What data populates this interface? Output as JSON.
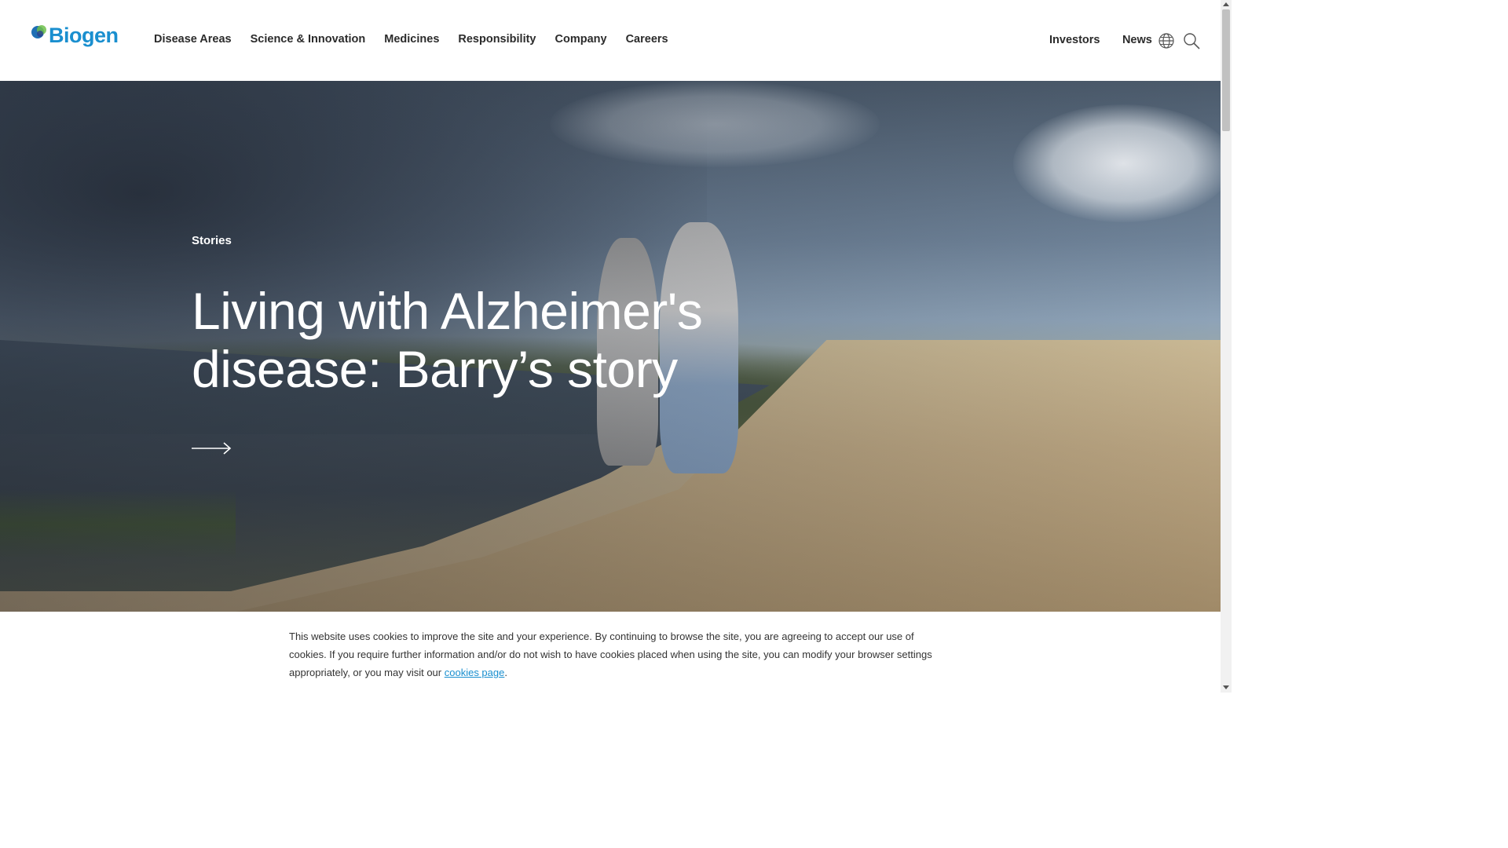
{
  "brand": {
    "name": "Biogen",
    "logo_icon": "biogen-logo-icon",
    "accent": "#1a8fcf"
  },
  "nav": {
    "items": [
      {
        "label": "Disease Areas"
      },
      {
        "label": "Science & Innovation"
      },
      {
        "label": "Medicines"
      },
      {
        "label": "Responsibility"
      },
      {
        "label": "Company"
      },
      {
        "label": "Careers"
      }
    ],
    "right": [
      {
        "label": "Investors"
      },
      {
        "label": "News"
      }
    ],
    "icons": [
      "globe-icon",
      "search-icon"
    ]
  },
  "hero": {
    "eyebrow": "Stories",
    "headline": "Living with Alzheimer's disease: Barry’s story",
    "cta_icon": "arrow-right-icon"
  },
  "cookie": {
    "text": "This website uses cookies to improve the site and your experience. By continuing to browse the site, you are agreeing to accept our use of cookies. If you require further information and/or do not wish to have cookies placed when using the site, you can modify your browser settings appropriately, or you may visit our ",
    "link_label": "cookies page",
    "suffix": "."
  }
}
